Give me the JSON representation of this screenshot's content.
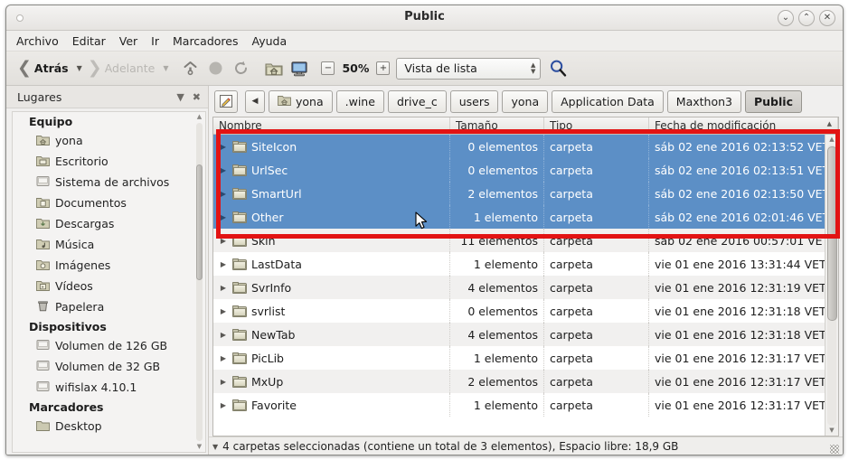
{
  "window": {
    "title": "Public",
    "controls": [
      {
        "name": "minimize",
        "glyph": "⌄"
      },
      {
        "name": "maximize",
        "glyph": "⌃"
      },
      {
        "name": "close",
        "glyph": "✕"
      }
    ]
  },
  "menubar": [
    "Archivo",
    "Editar",
    "Ver",
    "Ir",
    "Marcadores",
    "Ayuda"
  ],
  "toolbar": {
    "back_label": "Atrás",
    "forward_label": "Adelante",
    "zoom_percent": "50%",
    "zoom_out_glyph": "−",
    "zoom_in_glyph": "+",
    "view_mode": "Vista de lista",
    "icons": [
      "up-icon",
      "stop-icon",
      "reload-icon",
      "home-folder-icon",
      "computer-icon",
      "search-icon"
    ]
  },
  "sidebar": {
    "header": "Lugares",
    "groups": [
      {
        "label": "Equipo",
        "items": [
          {
            "label": "yona",
            "icon": "home-folder-icon"
          },
          {
            "label": "Escritorio",
            "icon": "desktop-folder-icon"
          },
          {
            "label": "Sistema de archivos",
            "icon": "drive-icon"
          },
          {
            "label": "Documentos",
            "icon": "documents-folder-icon"
          },
          {
            "label": "Descargas",
            "icon": "downloads-folder-icon"
          },
          {
            "label": "Música",
            "icon": "music-folder-icon"
          },
          {
            "label": "Imágenes",
            "icon": "pictures-folder-icon"
          },
          {
            "label": "Vídeos",
            "icon": "videos-folder-icon"
          },
          {
            "label": "Papelera",
            "icon": "trash-icon"
          }
        ]
      },
      {
        "label": "Dispositivos",
        "items": [
          {
            "label": "Volumen de 126 GB",
            "icon": "drive-icon"
          },
          {
            "label": "Volumen de 32 GB",
            "icon": "drive-icon"
          },
          {
            "label": "wifislax 4.10.1",
            "icon": "drive-icon"
          }
        ]
      },
      {
        "label": "Marcadores",
        "items": [
          {
            "label": "Desktop",
            "icon": "folder-icon"
          }
        ]
      }
    ]
  },
  "breadcrumb": {
    "edit_icon": "edit-location-icon",
    "prev_glyph": "◀",
    "items": [
      {
        "label": "yona",
        "icon": "home-folder-icon",
        "current": false
      },
      {
        "label": ".wine",
        "icon": "",
        "current": false
      },
      {
        "label": "drive_c",
        "icon": "",
        "current": false
      },
      {
        "label": "users",
        "icon": "",
        "current": false
      },
      {
        "label": "yona",
        "icon": "",
        "current": false
      },
      {
        "label": "Application Data",
        "icon": "",
        "current": false
      },
      {
        "label": "Maxthon3",
        "icon": "",
        "current": false
      },
      {
        "label": "Public",
        "icon": "",
        "current": true
      }
    ]
  },
  "filelist": {
    "columns": [
      "Nombre",
      "Tamaño",
      "Tipo",
      "Fecha de modificación"
    ],
    "sort_indicator": "▲",
    "rows": [
      {
        "name": "SiteIcon",
        "size": "0 elementos",
        "type": "carpeta",
        "date": "sáb 02 ene 2016 02:13:52 VET",
        "selected": true
      },
      {
        "name": "UrlSec",
        "size": "0 elementos",
        "type": "carpeta",
        "date": "sáb 02 ene 2016 02:13:51 VET",
        "selected": true
      },
      {
        "name": "SmartUrl",
        "size": "2 elementos",
        "type": "carpeta",
        "date": "sáb 02 ene 2016 02:13:50 VET",
        "selected": true
      },
      {
        "name": "Other",
        "size": "1 elemento",
        "type": "carpeta",
        "date": "sáb 02 ene 2016 02:01:46 VET",
        "selected": true
      },
      {
        "name": "Skin",
        "size": "11 elementos",
        "type": "carpeta",
        "date": "sáb 02 ene 2016 00:57:01 VET",
        "selected": false
      },
      {
        "name": "LastData",
        "size": "1 elemento",
        "type": "carpeta",
        "date": "vie 01 ene 2016 13:31:44 VET",
        "selected": false
      },
      {
        "name": "SvrInfo",
        "size": "4 elementos",
        "type": "carpeta",
        "date": "vie 01 ene 2016 12:31:19 VET",
        "selected": false
      },
      {
        "name": "svrlist",
        "size": "0 elementos",
        "type": "carpeta",
        "date": "vie 01 ene 2016 12:31:18 VET",
        "selected": false
      },
      {
        "name": "NewTab",
        "size": "4 elementos",
        "type": "carpeta",
        "date": "vie 01 ene 2016 12:31:18 VET",
        "selected": false
      },
      {
        "name": "PicLib",
        "size": "1 elemento",
        "type": "carpeta",
        "date": "vie 01 ene 2016 12:31:17 VET",
        "selected": false
      },
      {
        "name": "MxUp",
        "size": "2 elementos",
        "type": "carpeta",
        "date": "vie 01 ene 2016 12:31:17 VET",
        "selected": false
      },
      {
        "name": "Favorite",
        "size": "1 elemento",
        "type": "carpeta",
        "date": "vie 01 ene 2016 12:31:17 VET",
        "selected": false
      }
    ]
  },
  "statusbar": {
    "text": "4 carpetas seleccionadas (contiene un total de 3 elementos), Espacio libre: 18,9 GB"
  },
  "annotation": {
    "color": "#e21313",
    "shape": "rectangle"
  },
  "colors": {
    "selection_blue": "#5c8fc6",
    "window_bg": "#f0efee",
    "row_alt": "#f1f0ef"
  }
}
